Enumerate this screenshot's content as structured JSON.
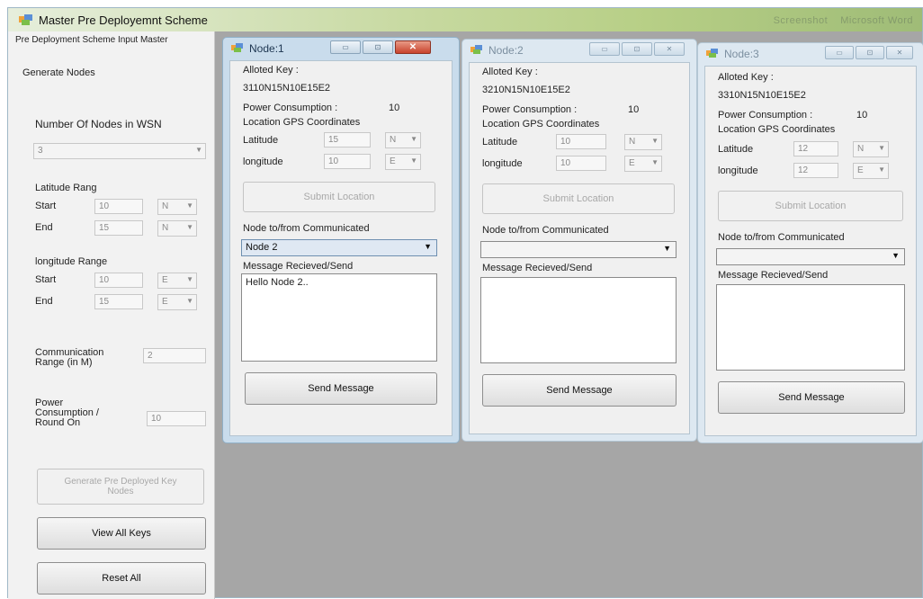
{
  "window": {
    "title": "Master Pre Deployemnt Scheme",
    "blurred_title_1": "Screenshot",
    "blurred_title_2": "Microsoft Word"
  },
  "master": {
    "header": "Pre Deployment Scheme Input Master",
    "generate_nodes": "Generate Nodes",
    "num_nodes_label": "Number Of Nodes in WSN",
    "num_nodes_value": "3",
    "lat_range_label": "Latitude Rang",
    "start_label": "Start",
    "end_label": "End",
    "lat_start": "10",
    "lat_start_dir": "N",
    "lat_end": "15",
    "lat_end_dir": "N",
    "long_range_label": "longitude Range",
    "long_start": "10",
    "long_start_dir": "E",
    "long_end": "15",
    "long_end_dir": "E",
    "comm_range_label": "Communication Range (in M)",
    "comm_range_value": "2",
    "power_label": "Power Consumption / Round On",
    "power_value": "10",
    "generate_btn": "Generate Pre Deployed Key Nodes",
    "view_keys_btn": "View All Keys",
    "reset_btn": "Reset All"
  },
  "nodes": [
    {
      "title": "Node:1",
      "alloted_key_label": "Alloted Key :",
      "key": "3110N15N10E15E2",
      "power_label": "Power Consumption :",
      "power": "10",
      "gps_label": "Location GPS Coordinates",
      "lat_label": "Latitude",
      "lat": "15",
      "lat_dir": "N",
      "long_label": "longitude",
      "long": "10",
      "long_dir": "E",
      "submit_btn": "Submit Location",
      "comm_label": "Node to/from Communicated",
      "comm_value": "Node 2",
      "msg_label": "Message Recieved/Send",
      "msg": "Hello Node 2..",
      "send_btn": "Send Message"
    },
    {
      "title": "Node:2",
      "alloted_key_label": "Alloted Key :",
      "key": "3210N15N10E15E2",
      "power_label": "Power Consumption :",
      "power": "10",
      "gps_label": "Location GPS Coordinates",
      "lat_label": "Latitude",
      "lat": "10",
      "lat_dir": "N",
      "long_label": "longitude",
      "long": "10",
      "long_dir": "E",
      "submit_btn": "Submit Location",
      "comm_label": "Node to/from Communicated",
      "comm_value": "",
      "msg_label": "Message Recieved/Send",
      "msg": "",
      "send_btn": "Send Message"
    },
    {
      "title": "Node:3",
      "alloted_key_label": "Alloted Key :",
      "key": "3310N15N10E15E2",
      "power_label": "Power Consumption :",
      "power": "10",
      "gps_label": "Location GPS Coordinates",
      "lat_label": "Latitude",
      "lat": "12",
      "lat_dir": "N",
      "long_label": "longitude",
      "long": "12",
      "long_dir": "E",
      "submit_btn": "Submit Location",
      "comm_label": "Node to/from Communicated",
      "comm_value": "",
      "msg_label": "Message Recieved/Send",
      "msg": "",
      "send_btn": "Send Message"
    }
  ]
}
